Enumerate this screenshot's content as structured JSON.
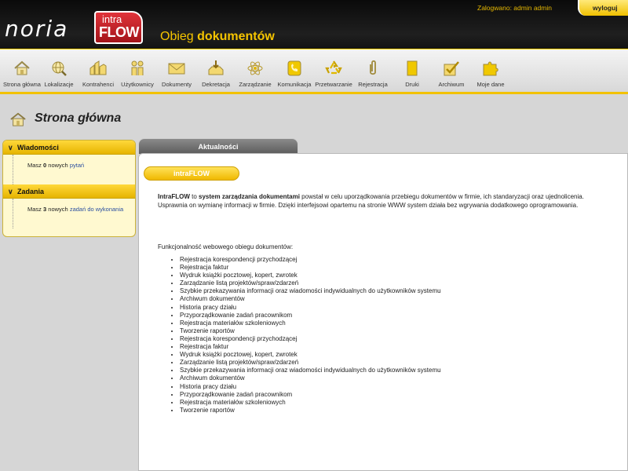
{
  "header": {
    "brand_noria": "noria",
    "brand_intra": "intra",
    "brand_flow": "FLOW",
    "app_title_prefix": "Obieg",
    "app_title_bold": "dokumentów",
    "login_info": "Zalogwano: admin admin",
    "logout_label": "wyloguj"
  },
  "toolbar": {
    "items": [
      {
        "label": "Strona główna",
        "icon": "home-icon"
      },
      {
        "label": "Lokalizacje",
        "icon": "globe-icon"
      },
      {
        "label": "Kontrahenci",
        "icon": "contractors-icon"
      },
      {
        "label": "Użytkownicy",
        "icon": "users-icon"
      },
      {
        "label": "Dokumenty",
        "icon": "envelope-icon"
      },
      {
        "label": "Dekretacja",
        "icon": "inbox-icon"
      },
      {
        "label": "Zarządzanie",
        "icon": "atom-icon"
      },
      {
        "label": "Komunikacja",
        "icon": "phone-icon"
      },
      {
        "label": "Przetwarzanie",
        "icon": "recycle-icon"
      },
      {
        "label": "Rejestracja",
        "icon": "paperclip-icon"
      },
      {
        "label": "Druki",
        "icon": "document-icon"
      },
      {
        "label": "Archiwum",
        "icon": "checkbox-icon"
      },
      {
        "label": "Moje dane",
        "icon": "puzzle-icon"
      }
    ]
  },
  "page": {
    "title": "Strona główna"
  },
  "sidebar": {
    "messages": {
      "title": "Wiadomości",
      "text_prefix": "Masz",
      "count": "0",
      "text_mid": "nowych",
      "link": "pytań"
    },
    "tasks": {
      "title": "Zadania",
      "text_prefix": "Masz",
      "count": "3",
      "text_mid": "nowych",
      "link": "zadań do wykonania"
    }
  },
  "news": {
    "tab_label": "Aktualności",
    "pill_label": "intraFLOW",
    "intro_bold1": "IntraFLOW",
    "intro_t1": " to ",
    "intro_bold2": "system zarządzania dokumentami",
    "intro_t2": " powstał w celu uporządkowania przebiegu dokumentów w firmie, ich standaryzacji oraz ujednolicenia. Usprawnia on wymianę informacji w firmie. Dzięki interfejsowi opartemu na stronie WWW system działa bez wgrywania dodatkowego oprogramowania.",
    "func_title": "Funkcjonalność webowego obiegu dokumentów:",
    "features": [
      "Rejestracja korespondencji przychodzącej",
      "Rejestracja faktur",
      "Wydruk książki pocztowej, kopert, zwrotek",
      "Zarządzanie listą projektów/spraw/zdarzeń",
      "Szybkie przekazywania informacji oraz wiadomości indywidualnych do użytkowników systemu",
      "Archiwum dokumentów",
      "Historia pracy działu",
      "Przyporządkowanie zadań pracownikom",
      "Rejestracja materiałów szkoleniowych",
      "Tworzenie raportów",
      "Rejestracja korespondencji przychodzącej",
      "Rejestracja faktur",
      "Wydruk książki pocztowej, kopert, zwrotek",
      "Zarządzanie listą projektów/spraw/zdarzeń",
      "Szybkie przekazywania informacji oraz wiadomości indywidualnych do użytkowników systemu",
      "Archiwum dokumentów",
      "Historia pracy działu",
      "Przyporządkowanie zadań pracownikom",
      "Rejestracja materiałów szkoleniowych",
      "Tworzenie raportów"
    ]
  },
  "colors": {
    "accent": "#f2c200",
    "header_bg": "#111111",
    "link": "#2b4fa0"
  }
}
